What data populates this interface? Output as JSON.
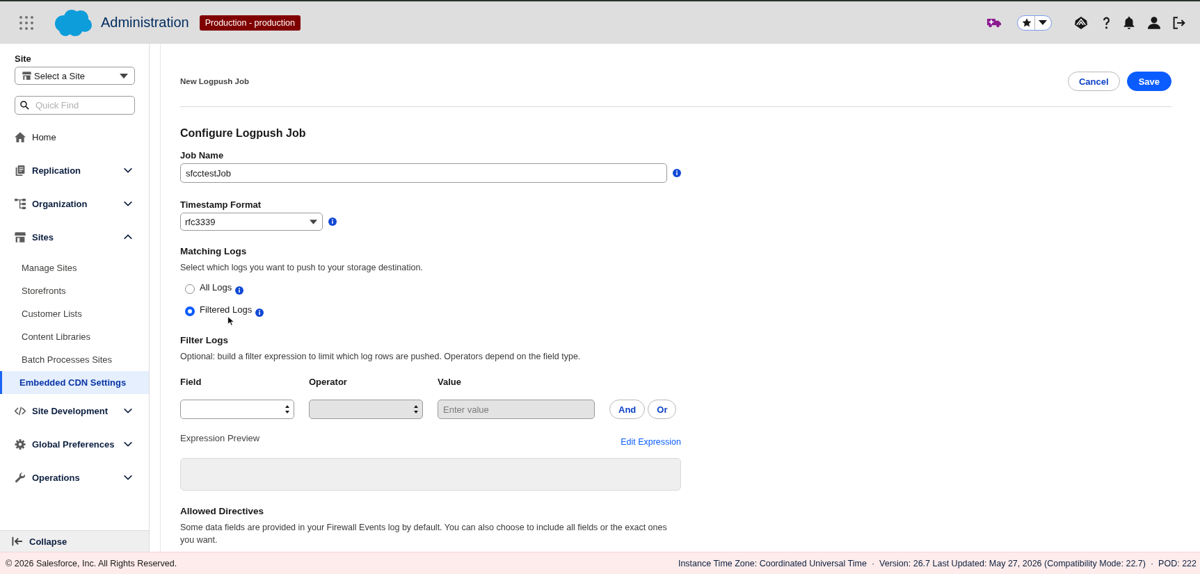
{
  "header": {
    "title": "Administration",
    "badge": "Production - production"
  },
  "sidebar": {
    "site_label": "Site",
    "site_select": {
      "value": "Select a Site"
    },
    "quick_find": {
      "placeholder": "Quick Find"
    },
    "items": [
      {
        "kind": "link",
        "label": "Home"
      },
      {
        "kind": "section",
        "label": "Replication",
        "expanded": false
      },
      {
        "kind": "section",
        "label": "Organization",
        "expanded": false
      },
      {
        "kind": "section",
        "label": "Sites",
        "expanded": true,
        "children": [
          {
            "label": "Manage Sites",
            "selected": false
          },
          {
            "label": "Storefronts",
            "selected": false
          },
          {
            "label": "Customer Lists",
            "selected": false
          },
          {
            "label": "Content Libraries",
            "selected": false
          },
          {
            "label": "Batch Processes Sites",
            "selected": false
          },
          {
            "label": "Embedded CDN Settings",
            "selected": true
          }
        ]
      },
      {
        "kind": "section",
        "label": "Site Development",
        "expanded": false
      },
      {
        "kind": "section",
        "label": "Global Preferences",
        "expanded": false
      },
      {
        "kind": "section",
        "label": "Operations",
        "expanded": false
      }
    ],
    "collapse": {
      "label": "Collapse"
    }
  },
  "page": {
    "title": "New Logpush Job",
    "buttons": [
      {
        "label": "Cancel",
        "kind": "neutral"
      },
      {
        "label": "Save",
        "kind": "brand"
      }
    ]
  },
  "form": {
    "title": "Configure Logpush Job",
    "job_name": {
      "label": "Job Name",
      "value": "sfcctestJob"
    },
    "timestamp_format": {
      "label": "Timestamp Format",
      "value": "rfc3339"
    },
    "matching_logs": {
      "title": "Matching Logs",
      "description": "Select which logs you want to push to your storage destination.",
      "options": [
        {
          "label": "All Logs",
          "selected": false
        },
        {
          "label": "Filtered Logs",
          "selected": true
        }
      ]
    },
    "filter_logs": {
      "title": "Filter Logs",
      "description": "Optional: build a filter expression to limit which log rows are pushed. Operators depend on the field type.",
      "controls": [
        {
          "kind": "select",
          "label": "Field",
          "disabled": false
        },
        {
          "kind": "select",
          "label": "Operator",
          "disabled": true
        },
        {
          "kind": "input",
          "label": "Value",
          "placeholder": "Enter value",
          "disabled": true
        }
      ],
      "buttons": [
        "And",
        "Or"
      ],
      "preview_label": "Expression Preview",
      "edit_link": "Edit Expression"
    },
    "allowed_directives": {
      "title": "Allowed Directives",
      "description": "Some data fields are provided in your Firewall Events log by default. You can also choose to include all fields or the exact ones you want."
    }
  },
  "footer": {
    "copyright": "© 2026 Salesforce, Inc. All Rights Reserved.",
    "info": [
      "Instance Time Zone: Coordinated Universal Time",
      "·",
      "Version: 26.7 Last Updated: May 27, 2026 (Compatibility Mode: 22.7)",
      "·",
      "POD: 222"
    ]
  }
}
